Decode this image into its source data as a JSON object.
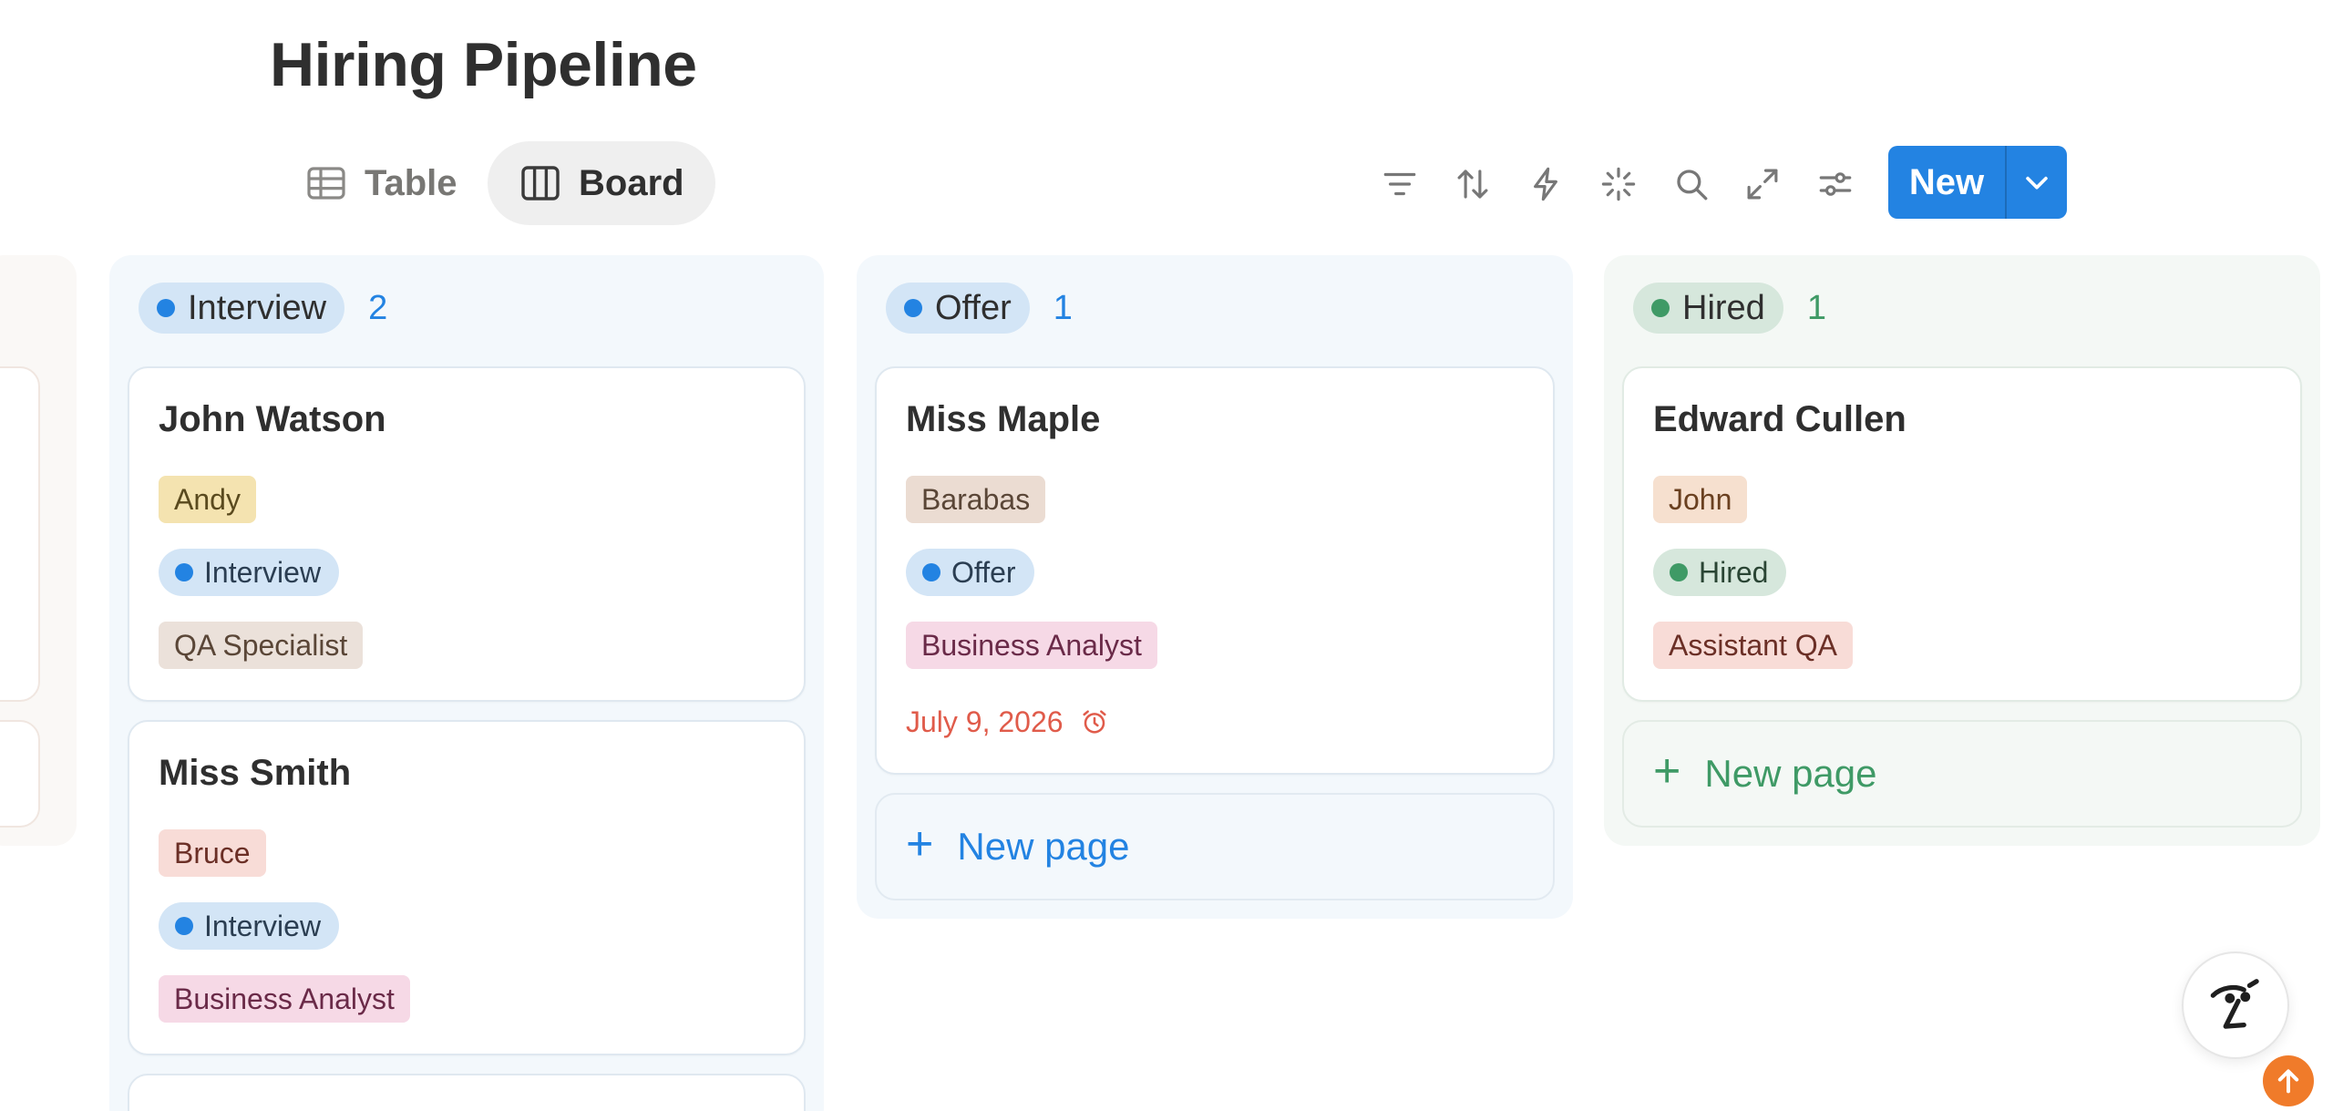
{
  "page": {
    "title": "Hiring Pipeline"
  },
  "views": {
    "table": {
      "label": "Table",
      "icon": "table-icon"
    },
    "board": {
      "label": "Board",
      "icon": "board-icon",
      "active": true
    }
  },
  "toolbar": {
    "icons": [
      "filter-icon",
      "sort-icon",
      "automation-icon",
      "ai-sparkle-icon",
      "search-icon",
      "expand-icon",
      "settings-sliders-icon"
    ],
    "new_label": "New",
    "new_dropdown_icon": "chevron-down-icon"
  },
  "colors": {
    "accent": "#2383e2",
    "blue_dot": "#2383e2",
    "green_dot": "#3f9a66",
    "date_red": "#e05b4a"
  },
  "columns": {
    "interview": {
      "name": "Interview",
      "count": "2",
      "cards": [
        {
          "title": "John Watson",
          "owner": "Andy",
          "status": "Interview",
          "role": "QA Specialist"
        },
        {
          "title": "Miss Smith",
          "owner": "Bruce",
          "status": "Interview",
          "role": "Business Analyst"
        }
      ]
    },
    "offer": {
      "name": "Offer",
      "count": "1",
      "cards": [
        {
          "title": "Miss Maple",
          "owner": "Barabas",
          "status": "Offer",
          "role": "Business Analyst",
          "date": "July 9, 2026",
          "date_icon": "alarm-clock-icon"
        }
      ],
      "new_page_label": "New page"
    },
    "hired": {
      "name": "Hired",
      "count": "1",
      "cards": [
        {
          "title": "Edward Cullen",
          "owner": "John",
          "status": "Hired",
          "role": "Assistant QA"
        }
      ],
      "new_page_label": "New page"
    }
  },
  "floating": {
    "assistant_icon": "ai-assistant-face-icon",
    "scroll_top_icon": "arrow-up-icon"
  }
}
